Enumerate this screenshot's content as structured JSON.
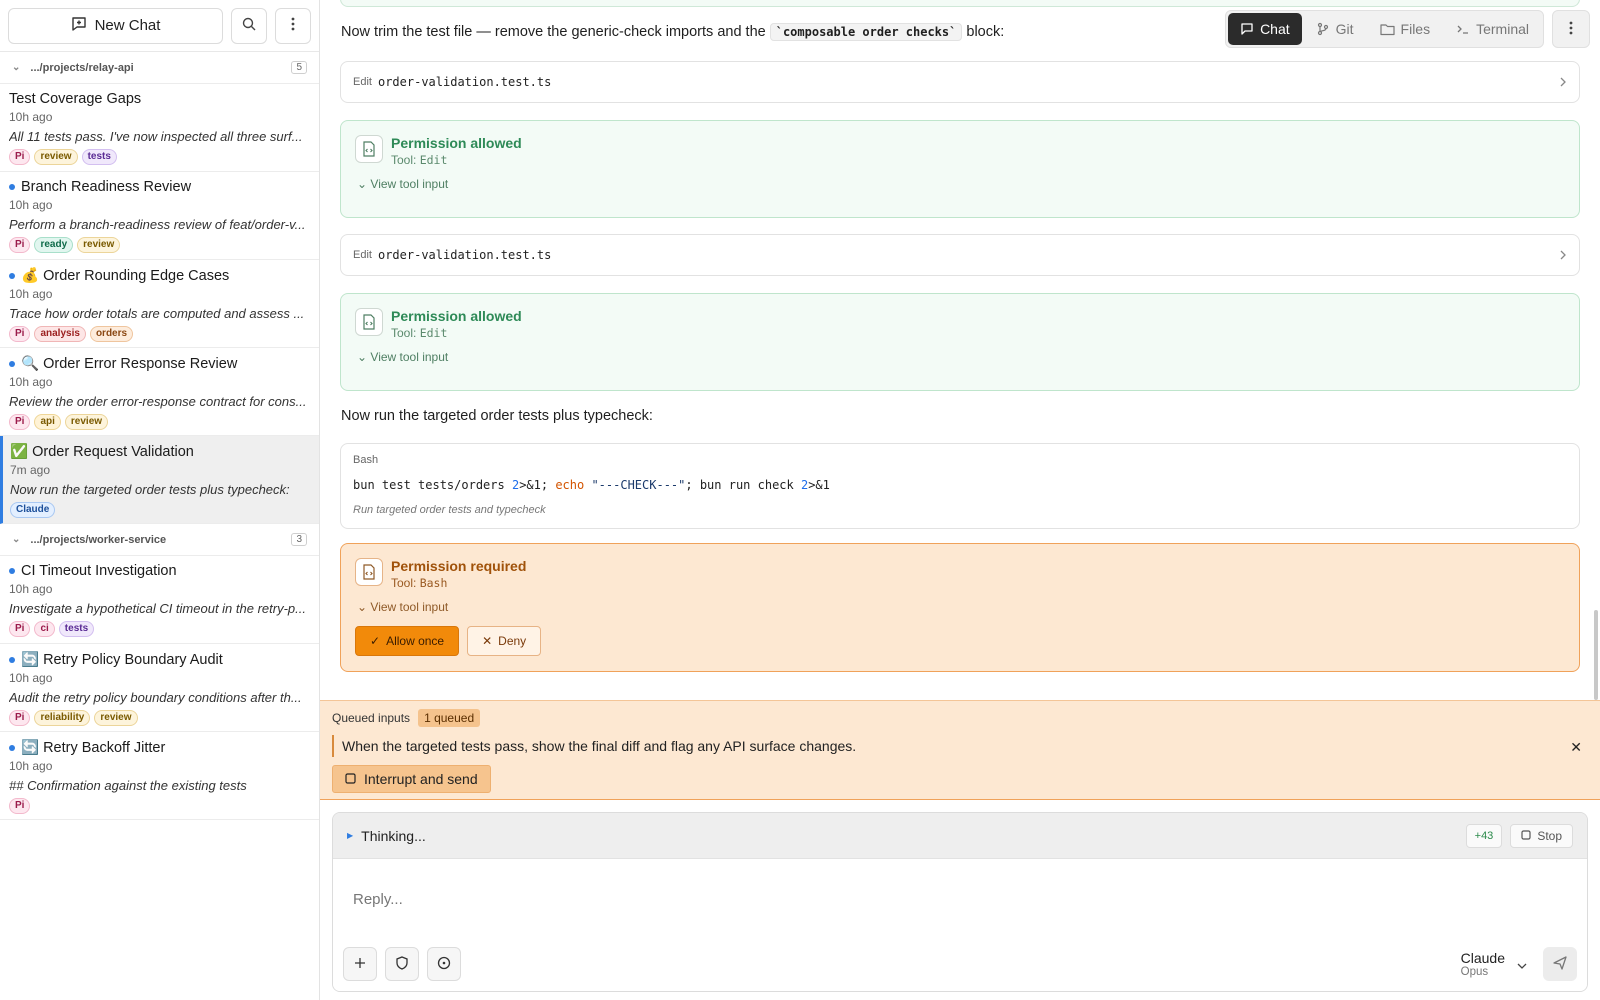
{
  "sidebar": {
    "new_chat_label": "New Chat",
    "groups": [
      {
        "path": ".../projects/relay-api",
        "count": "5",
        "items": [
          {
            "title": "Test Coverage Gaps",
            "dot": false,
            "time": "10h ago",
            "preview": "All 11 tests pass. I've now inspected all three surf...",
            "tags": [
              {
                "t": "Pi",
                "c": "pi"
              },
              {
                "t": "review",
                "c": "review"
              },
              {
                "t": "tests",
                "c": "tests"
              }
            ]
          },
          {
            "title": "Branch Readiness Review",
            "dot": true,
            "time": "10h ago",
            "preview": "Perform a branch-readiness review of feat/order-v...",
            "tags": [
              {
                "t": "Pi",
                "c": "pi"
              },
              {
                "t": "ready",
                "c": "ready"
              },
              {
                "t": "review",
                "c": "review"
              }
            ]
          },
          {
            "title": "💰 Order Rounding Edge Cases",
            "dot": true,
            "time": "10h ago",
            "preview": "Trace how order totals are computed and assess ...",
            "tags": [
              {
                "t": "Pi",
                "c": "pi"
              },
              {
                "t": "analysis",
                "c": "analysis"
              },
              {
                "t": "orders",
                "c": "orders"
              }
            ]
          },
          {
            "title": "🔍 Order Error Response Review",
            "dot": true,
            "time": "10h ago",
            "preview": "Review the order error-response contract for cons...",
            "tags": [
              {
                "t": "Pi",
                "c": "pi"
              },
              {
                "t": "api",
                "c": "api"
              },
              {
                "t": "review",
                "c": "review"
              }
            ]
          },
          {
            "title": "✅ Order Request Validation",
            "dot": false,
            "active": true,
            "time": "7m ago",
            "preview": "Now run the targeted order tests plus typecheck:",
            "tags": [
              {
                "t": "Claude",
                "c": "claude"
              }
            ]
          }
        ]
      },
      {
        "path": ".../projects/worker-service",
        "count": "3",
        "items": [
          {
            "title": "CI Timeout Investigation",
            "dot": true,
            "time": "10h ago",
            "preview": "Investigate a hypothetical CI timeout in the retry-p...",
            "tags": [
              {
                "t": "Pi",
                "c": "pi"
              },
              {
                "t": "ci",
                "c": "ci"
              },
              {
                "t": "tests",
                "c": "tests"
              }
            ]
          },
          {
            "title": "🔄 Retry Policy Boundary Audit",
            "dot": true,
            "time": "10h ago",
            "preview": "Audit the retry policy boundary conditions after th...",
            "tags": [
              {
                "t": "Pi",
                "c": "pi"
              },
              {
                "t": "reliability",
                "c": "reliability"
              },
              {
                "t": "review",
                "c": "review"
              }
            ]
          },
          {
            "title": "🔄 Retry Backoff Jitter",
            "dot": true,
            "time": "10h ago",
            "preview": "## Confirmation against the existing tests",
            "tags": [
              {
                "t": "Pi",
                "c": "pi"
              }
            ]
          }
        ]
      }
    ]
  },
  "topbar": {
    "tabs": [
      {
        "label": "Chat",
        "icon": "chat-icon",
        "active": true
      },
      {
        "label": "Git",
        "icon": "git-icon"
      },
      {
        "label": "Files",
        "icon": "folder-icon"
      },
      {
        "label": "Terminal",
        "icon": "terminal-icon"
      }
    ]
  },
  "conversation": {
    "msg1_before": "Now trim the test file — remove the generic-check imports and the",
    "msg1_code": "`composable order checks`",
    "msg1_after": "block:",
    "edit1": {
      "label": "Edit",
      "file": "order-validation.test.ts"
    },
    "perm1": {
      "title": "Permission allowed",
      "tool_prefix": "Tool:",
      "tool": "Edit",
      "view": "View tool input"
    },
    "edit2": {
      "label": "Edit",
      "file": "order-validation.test.ts"
    },
    "perm2": {
      "title": "Permission allowed",
      "tool_prefix": "Tool:",
      "tool": "Edit",
      "view": "View tool input"
    },
    "msg2": "Now run the targeted order tests plus typecheck:",
    "bash": {
      "label": "Bash",
      "cmd_a": "bun test tests/orders ",
      "cmd_b": "2",
      "cmd_c": ">&1; ",
      "cmd_d": "echo",
      "cmd_e": " ",
      "cmd_f": "\"---CHECK---\"",
      "cmd_g": "; bun run check ",
      "cmd_h": "2",
      "cmd_i": ">&1",
      "description": "Run targeted order tests and typecheck"
    },
    "perm3": {
      "title": "Permission required",
      "tool_prefix": "Tool:",
      "tool": "Bash",
      "view": "View tool input",
      "allow": "Allow once",
      "deny": "Deny"
    }
  },
  "queue": {
    "label": "Queued inputs",
    "badge": "1 queued",
    "item": "When the targeted tests pass, show the final diff and flag any API surface changes.",
    "interrupt": "Interrupt and send"
  },
  "composer": {
    "thinking": "Thinking...",
    "plus_count": "+43",
    "stop": "Stop",
    "placeholder": "Reply...",
    "model_name": "Claude",
    "model_variant": "Opus"
  }
}
